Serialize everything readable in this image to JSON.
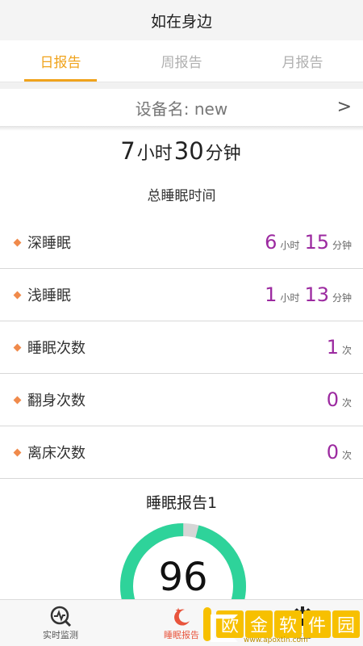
{
  "header": {
    "title": "如在身边"
  },
  "tabs": [
    {
      "label": "日报告",
      "active": true
    },
    {
      "label": "周报告",
      "active": false
    },
    {
      "label": "月报告",
      "active": false
    }
  ],
  "device": {
    "label": "设备名: new",
    "chevron": ">"
  },
  "total": {
    "hours": "7",
    "hours_unit": "小时",
    "minutes": "30",
    "minutes_unit": "分钟",
    "label": "总睡眠时间"
  },
  "rows": [
    {
      "name": "深睡眠",
      "v1": "6",
      "u1": "小时",
      "v2": "15",
      "u2": "分钟"
    },
    {
      "name": "浅睡眠",
      "v1": "1",
      "u1": "小时",
      "v2": "13",
      "u2": "分钟"
    },
    {
      "name": "睡眠次数",
      "v1": "1",
      "u1": "次"
    },
    {
      "name": "翻身次数",
      "v1": "0",
      "u1": "次"
    },
    {
      "name": "离床次数",
      "v1": "0",
      "u1": "次"
    }
  ],
  "report": {
    "title": "睡眠报告1",
    "score": "96",
    "score_fraction": 0.96
  },
  "bottom_nav": [
    {
      "label": "实时监测",
      "icon": "monitor-chart-icon"
    },
    {
      "label": "睡眠报告",
      "icon": "moon-star-icon",
      "active": true
    },
    {
      "label": "设置",
      "icon": "gear-icon"
    }
  ],
  "watermark": {
    "text": [
      "欧",
      "金",
      "软",
      "件",
      "园"
    ],
    "url": "www.apoxtin.com"
  },
  "colors": {
    "accent": "#f0a31c",
    "value": "#9c2aa0",
    "gauge": "#2ed39a",
    "gauge_track": "#d6d6d6",
    "bullet": "#f08a4b"
  }
}
